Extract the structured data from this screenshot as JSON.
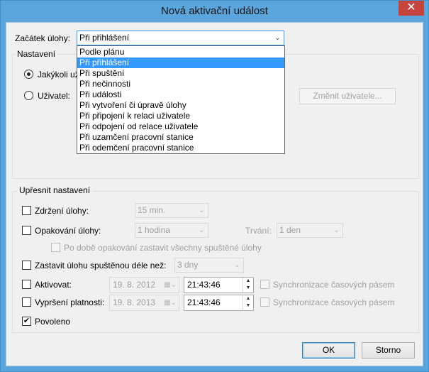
{
  "window": {
    "title": "Nová aktivační událost",
    "close_glyph": "✕"
  },
  "start": {
    "label": "Začátek úlohy:",
    "selected": "Při přihlášení",
    "options": [
      "Podle plánu",
      "Při přihlášení",
      "Při spuštění",
      "Při nečinnosti",
      "Při události",
      "Při vytvoření či úpravě úlohy",
      "Při připojení k relaci uživatele",
      "Při odpojení od relace uživatele",
      "Při uzamčení pracovní stanice",
      "Při odemčení pracovní stanice"
    ],
    "highlighted_index": 1
  },
  "settings": {
    "title": "Nastavení",
    "any_user_label": "Jakýkoli už",
    "user_label": "Uživatel:",
    "change_user_button": "Změnit uživatele..."
  },
  "advanced": {
    "title": "Upřesnit nastavení",
    "delay_label": "Zdržení úlohy:",
    "delay_value": "15 min.",
    "repeat_label": "Opakování úlohy:",
    "repeat_value": "1 hodina",
    "duration_label": "Trvání:",
    "duration_value": "1 den",
    "stop_repeat_label": "Po době opakování zastavit všechny spuštěné úlohy",
    "stop_longer_label": "Zastavit úlohu spuštěnou déle než:",
    "stop_longer_value": "3 dny",
    "activate_label": "Aktivovat:",
    "activate_date": "19.   8. 2012",
    "activate_time": "21:43:46",
    "expire_label": "Vypršení platnosti:",
    "expire_date": "19.   8. 2013",
    "expire_time": "21:43:46",
    "sync_label": "Synchronizace časových pásem",
    "enabled_label": "Povoleno",
    "check_glyph": "✔"
  },
  "buttons": {
    "ok": "OK",
    "cancel": "Storno"
  },
  "icons": {
    "dropdown": "chevron-down-icon",
    "spin_up": "▲",
    "spin_down": "▼"
  }
}
